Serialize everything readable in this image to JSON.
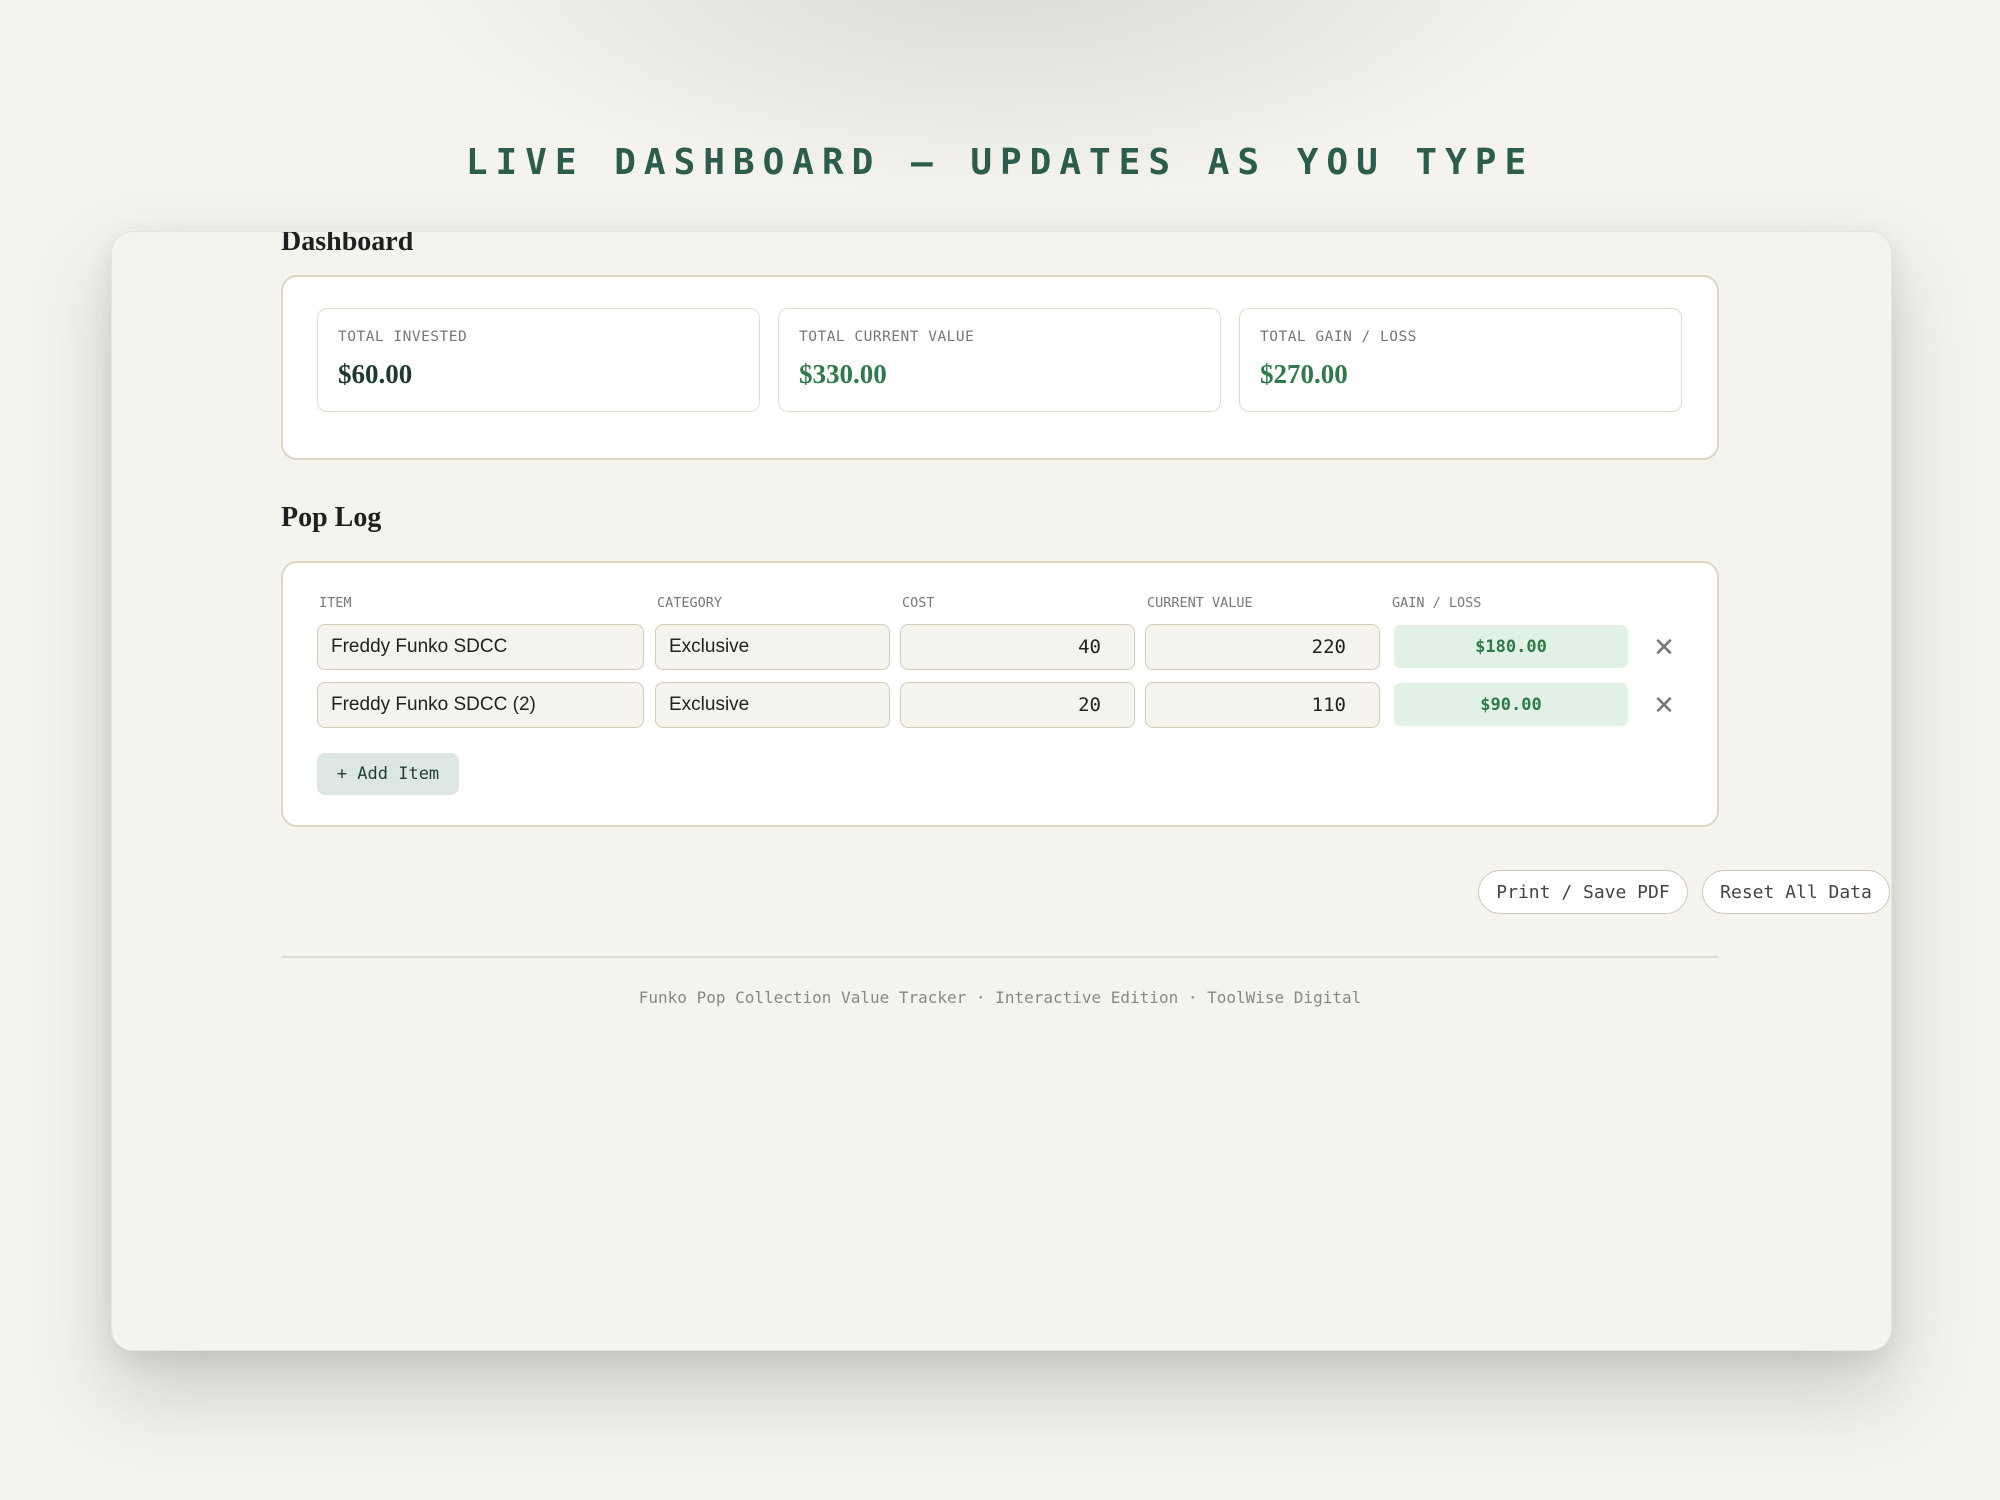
{
  "banner": "LIVE DASHBOARD — UPDATES AS YOU TYPE",
  "dashboard": {
    "title": "Dashboard",
    "stats": [
      {
        "label": "TOTAL INVESTED",
        "value": "$60.00",
        "color": "#1e3a32"
      },
      {
        "label": "TOTAL CURRENT VALUE",
        "value": "$330.00",
        "color": "#2e7a4a"
      },
      {
        "label": "TOTAL GAIN / LOSS",
        "value": "$270.00",
        "color": "#2e7a4a"
      }
    ]
  },
  "pop_log": {
    "title": "Pop Log",
    "columns": [
      "ITEM",
      "CATEGORY",
      "COST",
      "CURRENT VALUE",
      "GAIN / LOSS"
    ],
    "rows": [
      {
        "item": "Freddy Funko SDCC",
        "category": "Exclusive",
        "cost": "40",
        "current_value": "220",
        "gain": "$180.00"
      },
      {
        "item": "Freddy Funko SDCC (2)",
        "category": "Exclusive",
        "cost": "20",
        "current_value": "110",
        "gain": "$90.00"
      }
    ],
    "delete_glyph": "✕",
    "add_label": "+ Add Item"
  },
  "actions": {
    "print_label": "Print / Save PDF",
    "reset_label": "Reset All Data"
  },
  "footer": "Funko Pop Collection Value Tracker · Interactive Edition · ToolWise Digital",
  "colors": {
    "accent": "#2c5c4c",
    "positive": "#2e7a4a",
    "gain_bg": "#e1f1e5",
    "page_bg": "#f4f3ee"
  }
}
